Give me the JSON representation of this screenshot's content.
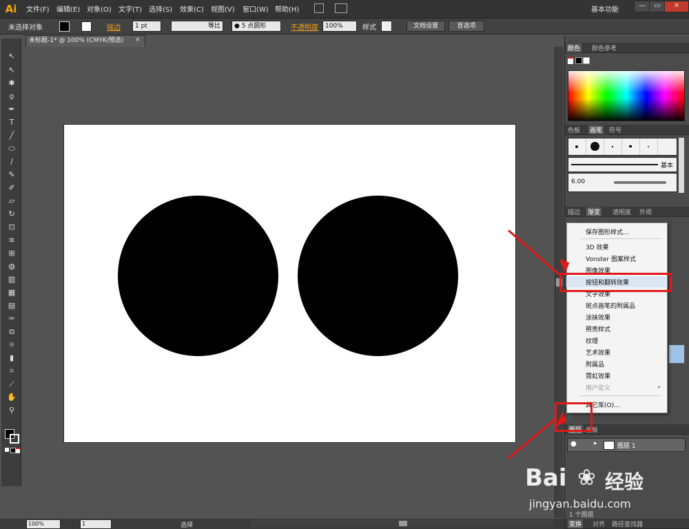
{
  "app": {
    "logo": "Ai",
    "workspace": "基本功能"
  },
  "menus": [
    "文件(F)",
    "编辑(E)",
    "对象(O)",
    "文字(T)",
    "选择(S)",
    "效果(C)",
    "视图(V)",
    "窗口(W)",
    "帮助(H)"
  ],
  "window_controls": {
    "minimize": "—",
    "restore": "▭",
    "close": "✕"
  },
  "controlbar": {
    "selection": "未选择对象",
    "stroke_label": "描边",
    "stroke_weight": "1 pt",
    "stroke_profile": "等比",
    "brush": "● 5 点圆形",
    "opacity_label": "不透明度",
    "opacity_value": "100%",
    "style_label": "样式",
    "doc_setup": "文档设置",
    "preferences": "首选项"
  },
  "document": {
    "tab_title": "未标题-1* @ 100% (CMYK/预选)",
    "close": "×"
  },
  "status": {
    "zoom": "100%",
    "page": "1",
    "tool": "选择"
  },
  "panels": {
    "color_tabs": [
      "颜色",
      "颜色参考"
    ],
    "brush_tabs": [
      "色板",
      "画笔",
      "符号"
    ],
    "brush_basic": "基本",
    "brush_size": "6.00",
    "appearance_tabs": [
      "描边",
      "渐变",
      "透明度",
      "外观"
    ],
    "layers_tabs": [
      "图层",
      "画板"
    ],
    "layer_name": "图层 1",
    "bottom_tabs": [
      "变换",
      "对齐",
      "路径查找器"
    ],
    "bottom_layer_count": "1 个图层"
  },
  "graphic_style_menu": {
    "items": [
      {
        "label": "保存图形样式...",
        "disabled": false
      },
      {
        "label": "3D 效果",
        "disabled": false
      },
      {
        "label": "Vonster 图案样式",
        "disabled": false
      },
      {
        "label": "图像效果",
        "disabled": false
      },
      {
        "label": "按钮和翻转效果",
        "disabled": false,
        "highlighted": true
      },
      {
        "label": "文字效果",
        "disabled": false
      },
      {
        "label": "斑点画笔的附属品",
        "disabled": false
      },
      {
        "label": "涂抹效果",
        "disabled": false
      },
      {
        "label": "照亮样式",
        "disabled": false
      },
      {
        "label": "纹理",
        "disabled": false
      },
      {
        "label": "艺术效果",
        "disabled": false
      },
      {
        "label": "附属品",
        "disabled": false
      },
      {
        "label": "霓虹效果",
        "disabled": false
      },
      {
        "label": "用户定义",
        "disabled": true
      },
      {
        "label": "其它库(O)...",
        "disabled": false
      }
    ]
  },
  "watermark": {
    "brand": "Bai",
    "brand2": "经验",
    "url": "jingyan.baidu.com"
  },
  "colors": {
    "accent_red": "#e01818",
    "logo_orange": "#f7a600",
    "circle": "#000000",
    "artboard": "#ffffff"
  }
}
